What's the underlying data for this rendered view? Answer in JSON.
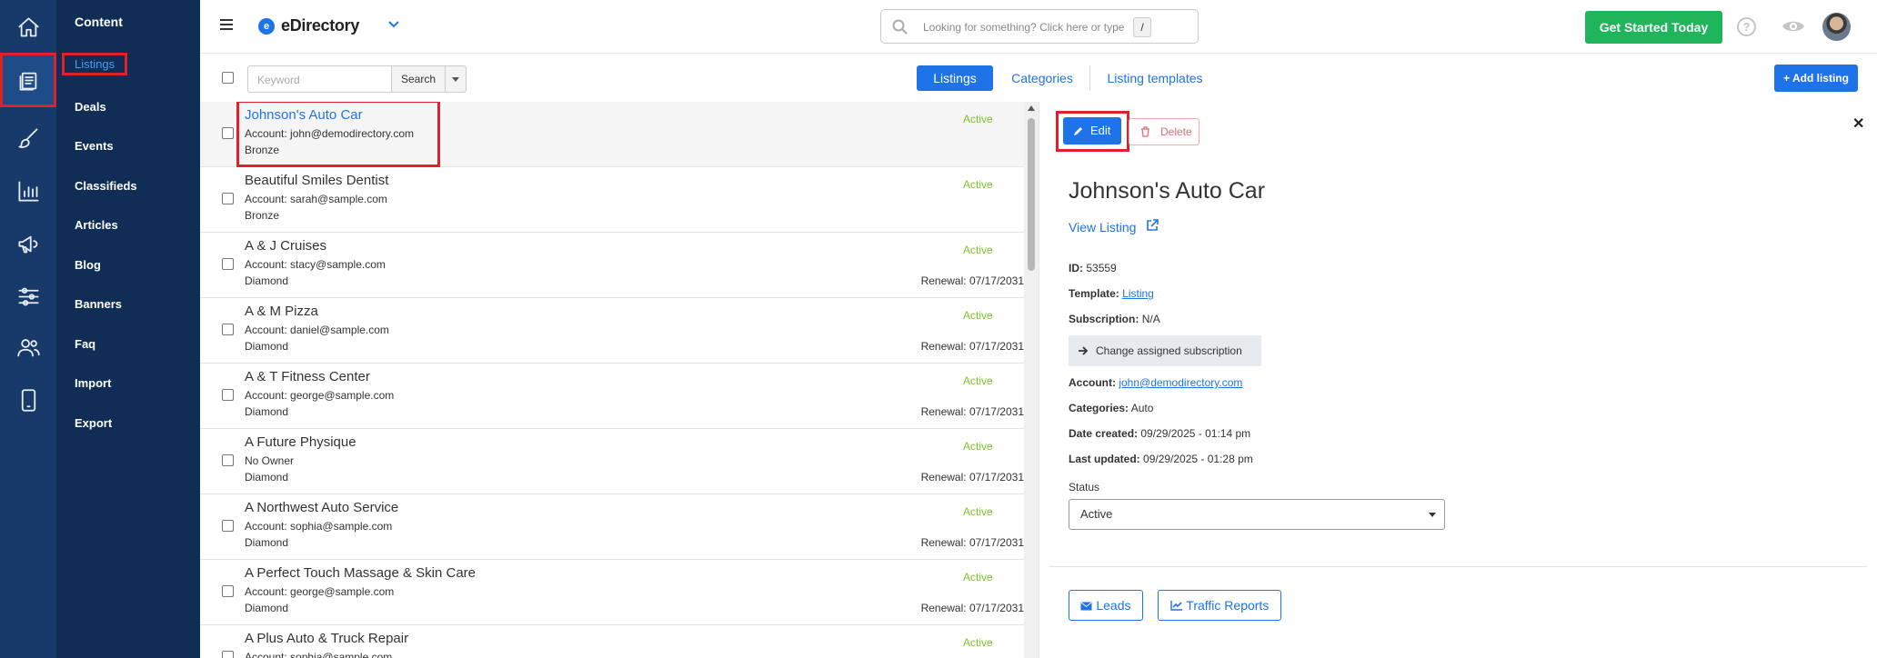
{
  "app": {
    "name": "eDirectory",
    "logo_letter": "e"
  },
  "search": {
    "placeholder": "Looking for something? Click here or type",
    "shortcut": "/"
  },
  "topbar": {
    "cta": "Get Started Today",
    "help": "?"
  },
  "sidebar": {
    "heading": "Content",
    "items": [
      "Listings",
      "Deals",
      "Events",
      "Classifieds",
      "Articles",
      "Blog",
      "Banners",
      "Faq",
      "Import",
      "Export"
    ],
    "active": "Listings"
  },
  "rail": [
    "home-icon",
    "content-icon",
    "design-icon",
    "reports-icon",
    "promote-icon",
    "settings-icon",
    "users-icon",
    "mobile-icon"
  ],
  "toolbar": {
    "keyword_placeholder": "Keyword",
    "search_label": "Search",
    "tabs": [
      "Listings",
      "Categories",
      "Listing templates"
    ],
    "add_label": "+ Add listing"
  },
  "listings": [
    {
      "name": "Johnson's Auto Car",
      "account": "Account: john@demodirectory.com",
      "level": "Bronze",
      "status": "Active",
      "renewal": ""
    },
    {
      "name": "Beautiful Smiles Dentist",
      "account": "Account: sarah@sample.com",
      "level": "Bronze",
      "status": "Active",
      "renewal": ""
    },
    {
      "name": "A & J Cruises",
      "account": "Account: stacy@sample.com",
      "level": "Diamond",
      "status": "Active",
      "renewal": "Renewal: 07/17/2031"
    },
    {
      "name": "A & M Pizza",
      "account": "Account: daniel@sample.com",
      "level": "Diamond",
      "status": "Active",
      "renewal": "Renewal: 07/17/2031"
    },
    {
      "name": "A & T Fitness Center",
      "account": "Account: george@sample.com",
      "level": "Diamond",
      "status": "Active",
      "renewal": "Renewal: 07/17/2031"
    },
    {
      "name": "A Future Physique",
      "account": "No Owner",
      "level": "Diamond",
      "status": "Active",
      "renewal": "Renewal: 07/17/2031"
    },
    {
      "name": "A Northwest Auto Service",
      "account": "Account: sophia@sample.com",
      "level": "Diamond",
      "status": "Active",
      "renewal": "Renewal: 07/17/2031"
    },
    {
      "name": "A Perfect Touch Massage & Skin Care",
      "account": "Account: george@sample.com",
      "level": "Diamond",
      "status": "Active",
      "renewal": "Renewal: 07/17/2031"
    },
    {
      "name": "A Plus Auto & Truck Repair",
      "account": "Account: sophia@sample.com",
      "level": "",
      "status": "Active",
      "renewal": ""
    }
  ],
  "detail": {
    "edit_label": "Edit",
    "delete_label": "Delete",
    "close": "✕",
    "title": "Johnson's Auto Car",
    "view_link": "View Listing",
    "id_label": "ID:",
    "id_value": "53559",
    "template_label": "Template:",
    "template_value": "Listing",
    "subscription_label": "Subscription:",
    "subscription_value": "N/A",
    "change_sub": "Change assigned subscription",
    "account_label": "Account:",
    "account_value": "john@demodirectory.com",
    "categories_label": "Categories:",
    "categories_value": "Auto",
    "created_label": "Date created:",
    "created_value": "09/29/2025 - 01:14 pm",
    "updated_label": "Last updated:",
    "updated_value": "09/29/2025 - 01:28 pm",
    "status_label": "Status",
    "status_value": "Active",
    "leads_label": "Leads",
    "traffic_label": "Traffic Reports"
  },
  "colors": {
    "rail": "#173a6a",
    "sidebar": "#102d55",
    "primary": "#1e73e8",
    "cta": "#1fb55a",
    "status_active": "#7cc22a",
    "highlight": "#e0202a"
  }
}
